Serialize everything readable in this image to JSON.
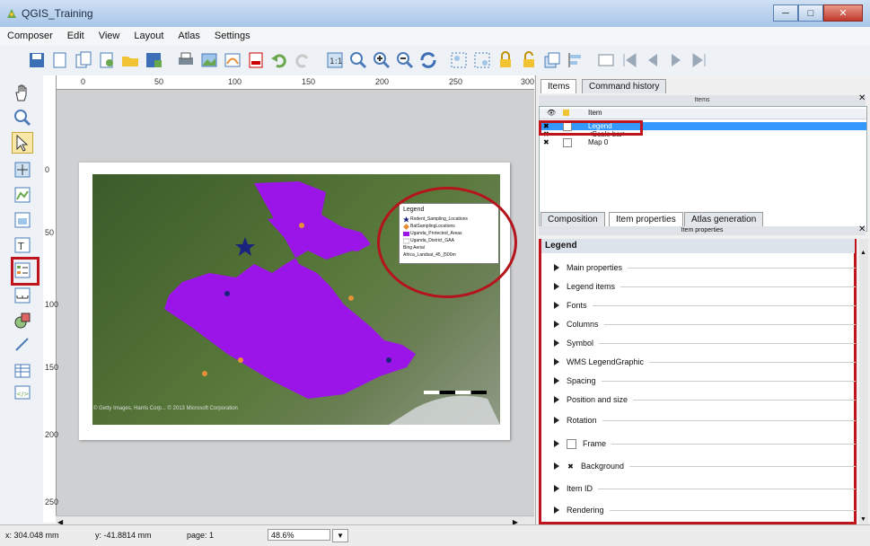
{
  "window": {
    "title": "QGIS_Training",
    "minimize": "─",
    "maximize": "□",
    "close": "✕"
  },
  "menu": [
    "Composer",
    "Edit",
    "View",
    "Layout",
    "Atlas",
    "Settings"
  ],
  "ruler": {
    "top": [
      "0",
      "50",
      "100",
      "150",
      "200",
      "250",
      "300"
    ],
    "left": [
      "0",
      "50",
      "100",
      "150",
      "200",
      "250"
    ]
  },
  "map": {
    "legend": {
      "title": "Legend",
      "items": [
        "Rodent_Sampling_Locations",
        "BatSamplingLocations",
        "Uganda_Protected_Areas",
        "Uganda_District_GAA",
        "Bing Aerial",
        "Africa_Landsat_45_(500m"
      ]
    },
    "copyright": "© Getty Images, Harris Corp... © 2013 Microsoft Corporation"
  },
  "panel": {
    "tabs_top": [
      "Items",
      "Command history"
    ],
    "items_header": "Items",
    "tree_cols": [
      "Item"
    ],
    "tree_rows": [
      "Legend",
      "<Scale bar>",
      "Map 0"
    ],
    "tabs_bottom": [
      "Composition",
      "Item properties",
      "Atlas generation"
    ],
    "ip_header": "Item properties",
    "props_title": "Legend",
    "groups": [
      "Main properties",
      "Legend items",
      "Fonts",
      "Columns",
      "Symbol",
      "WMS LegendGraphic",
      "Spacing",
      "Position and size",
      "Rotation",
      "Frame",
      "Background",
      "Item ID",
      "Rendering"
    ]
  },
  "status": {
    "x": "x: 304.048 mm",
    "y": "y: -41.8814 mm",
    "page": "page: 1",
    "zoom": "48.6%"
  }
}
